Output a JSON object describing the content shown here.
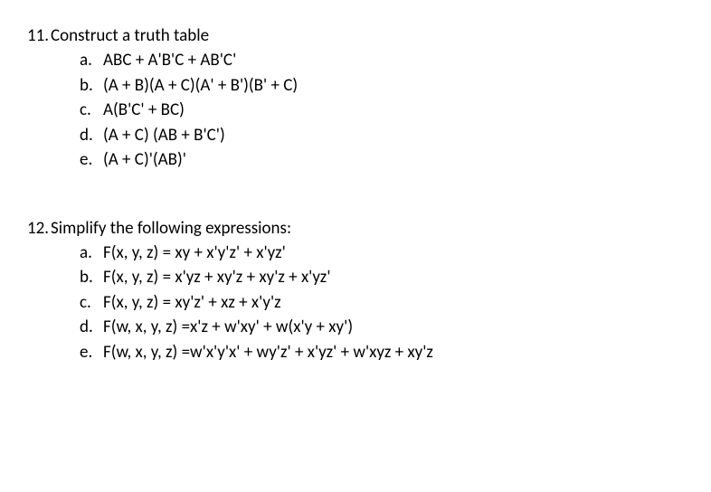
{
  "questions": [
    {
      "number": "11.",
      "text": "Construct a truth table",
      "items": [
        {
          "letter": "a.",
          "expr": "ABC + A'B'C + AB'C'"
        },
        {
          "letter": "b.",
          "expr": "(A + B)(A + C)(A' + B')(B' + C)"
        },
        {
          "letter": "c.",
          "expr": "A(B'C' + BC)"
        },
        {
          "letter": "d.",
          "expr": "(A + C) (AB + B'C')"
        },
        {
          "letter": "e.",
          "expr": "(A + C)'(AB)'"
        }
      ]
    },
    {
      "number": "12.",
      "text": "Simplify the following expressions:",
      "items": [
        {
          "letter": "a.",
          "expr": "F(x, y, z) = xy + x'y'z' + x'yz'"
        },
        {
          "letter": "b.",
          "expr": "F(x, y, z) = x'yz + xy'z + xy'z + x'yz'"
        },
        {
          "letter": "c.",
          "expr": "F(x, y, z) = xy'z' + xz + x'y'z"
        },
        {
          "letter": "d.",
          "expr": "F(w, x, y, z) =x'z + w'xy' + w(x'y + xy')"
        },
        {
          "letter": "e.",
          "expr": " F(w, x, y, z) =w'x'y'x' + wy'z' + x'yz' + w'xyz + xy'z"
        }
      ]
    }
  ]
}
